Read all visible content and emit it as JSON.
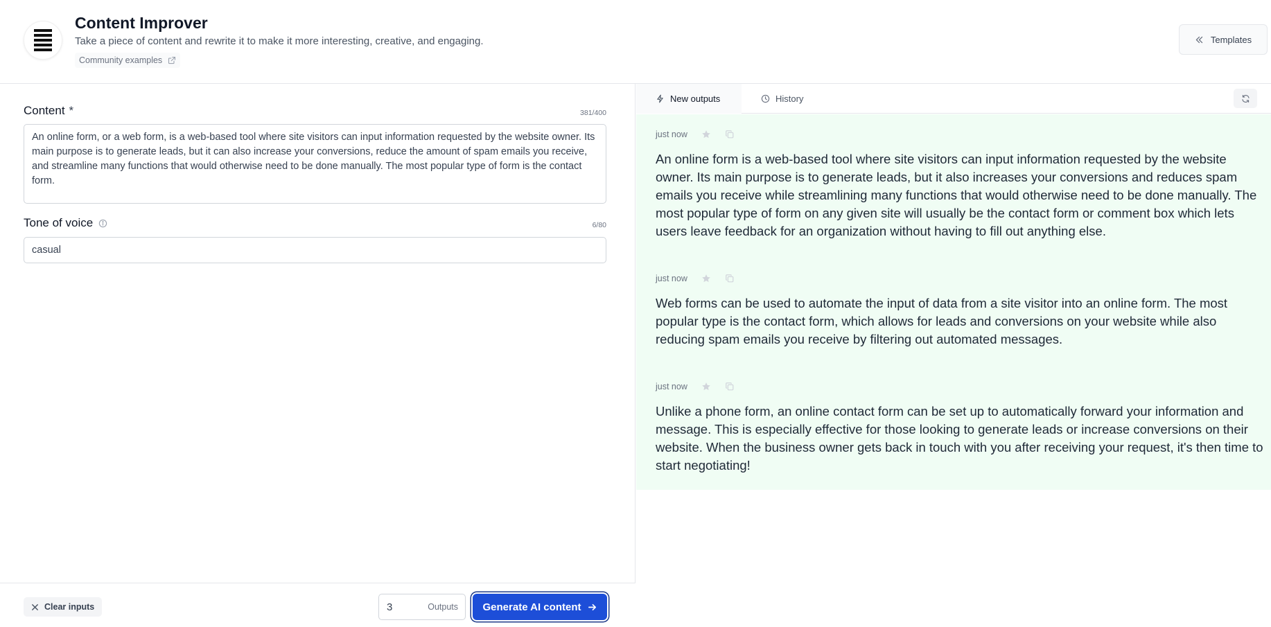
{
  "header": {
    "title": "Content Improver",
    "subtitle": "Take a piece of content and rewrite it to make it more interesting, creative, and engaging.",
    "community_link": "Community examples",
    "templates_label": "Templates"
  },
  "form": {
    "content": {
      "label": "Content",
      "required_mark": "*",
      "counter": "381/400",
      "value": "An online form, or a web form, is a web-based tool where site visitors can input information requested by the website owner. Its main purpose is to generate leads, but it can also increase your conversions, reduce the amount of spam emails you receive, and streamline many functions that would otherwise need to be done manually. The most popular type of form is the contact form."
    },
    "tone": {
      "label": "Tone of voice",
      "counter": "6/80",
      "value": "casual"
    }
  },
  "footer": {
    "clear_label": "Clear inputs",
    "outputs_value": "3",
    "outputs_label": "Outputs",
    "generate_label": "Generate AI content"
  },
  "right_panel": {
    "tabs": [
      {
        "label": "New outputs",
        "active": true
      },
      {
        "label": "History",
        "active": false
      }
    ],
    "outputs": [
      {
        "timestamp": "just now",
        "text": "An online form is a web-based tool where site visitors can input information requested by the website owner. Its main purpose is to generate leads, but it also increases your conversions and reduces spam emails you receive while streamlining many functions that would otherwise need to be done manually. The most popular type of form on any given site will usually be the contact form or comment box which lets users leave feedback for an organization without having to fill out anything else."
      },
      {
        "timestamp": "just now",
        "text": "Web forms can be used to automate the input of data from a site visitor into an online form. The most popular type is the contact form, which allows for leads and conversions on your website while also reducing spam emails you receive by filtering out automated messages."
      },
      {
        "timestamp": "just now",
        "text": "Unlike a phone form, an online contact form can be set up to automatically forward your information and message. This is especially effective for those looking to generate leads or increase conversions on their website. When the business owner gets back in touch with you after receiving your request, it's then time to start negotiating!"
      }
    ]
  },
  "colors": {
    "accent": "#1d4ed8",
    "output_background": "#f0fdf4"
  },
  "icons": [
    "app-logo-icon",
    "external-link-icon",
    "chevrons-left-icon",
    "info-icon",
    "close-icon",
    "arrow-right-icon",
    "lightning-icon",
    "clock-icon",
    "refresh-icon",
    "star-icon",
    "copy-icon"
  ]
}
